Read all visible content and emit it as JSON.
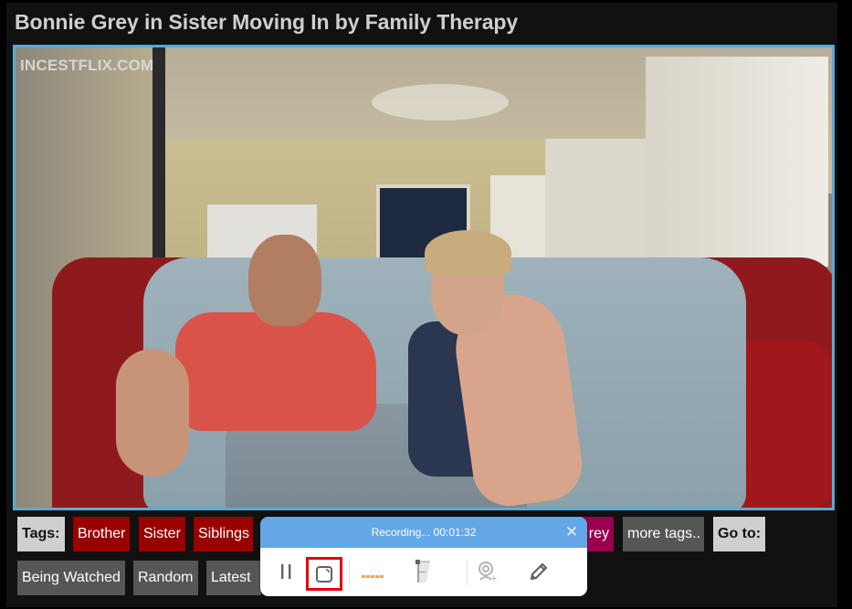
{
  "page": {
    "title": "Bonnie Grey in Sister Moving In by Family Therapy"
  },
  "video": {
    "watermark": "INCESTFLIX.COM",
    "frame_description": "Still frame: man in red t-shirt and woman in plaid shirt on a red sofa with light blue blanket, kitchen in background"
  },
  "tags": {
    "label": "Tags:",
    "items": [
      {
        "label": "Brother",
        "color": "#990000"
      },
      {
        "label": "Sister",
        "color": "#990000"
      },
      {
        "label": "Siblings",
        "color": "#990000"
      },
      {
        "label": "rey",
        "color": "#990050"
      }
    ],
    "more_label": "more tags.."
  },
  "goto": {
    "label": "Go to:",
    "links": [
      {
        "label": "Being Watched"
      },
      {
        "label": "Random"
      },
      {
        "label": "Latest"
      }
    ]
  },
  "recorder": {
    "status_text": "Recording... 00:01:32",
    "header_color": "#63a7e7",
    "close_icon": "close-icon",
    "buttons": [
      {
        "name": "pause",
        "icon": "pause-icon"
      },
      {
        "name": "stop",
        "icon": "stop-icon",
        "highlighted": true
      },
      {
        "name": "audio-level",
        "icon": "audio-level-icon"
      },
      {
        "name": "volume",
        "icon": "volume-slider-icon"
      },
      {
        "name": "webcam",
        "icon": "webcam-add-icon"
      },
      {
        "name": "annotate",
        "icon": "pencil-icon"
      }
    ],
    "highlight_color": "#e8000b"
  }
}
